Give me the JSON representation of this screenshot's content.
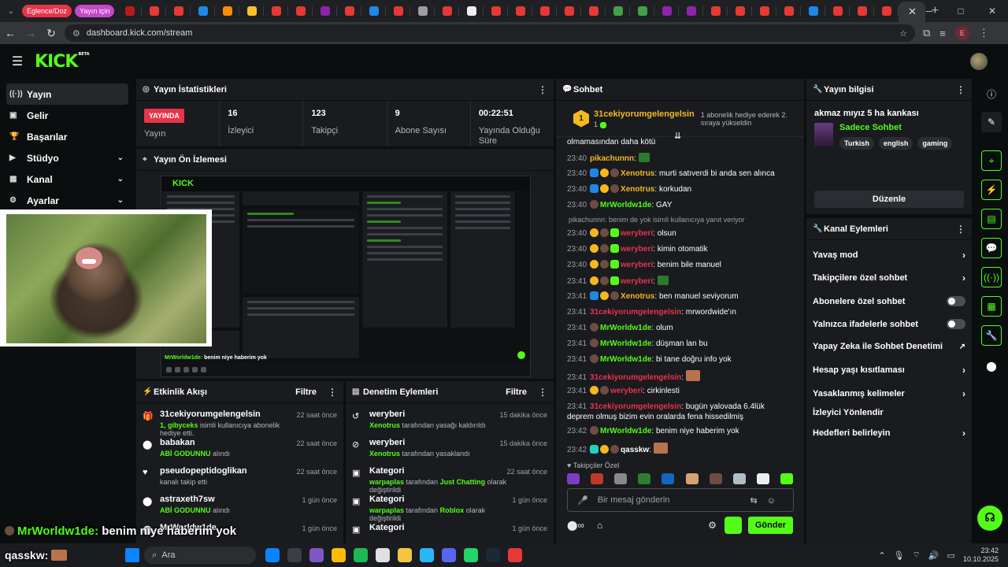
{
  "browser": {
    "tab_groups": [
      {
        "label": "Eglence/Doz",
        "color": "#e8344a"
      },
      {
        "label": "Yayın için",
        "color": "#c548c9"
      }
    ],
    "mini_tab_colors": [
      "#b71c1c",
      "#e53935",
      "#e53935",
      "#1e88e5",
      "#fb8c00",
      "#fbc02d",
      "#e53935",
      "#e53935",
      "#8e24aa",
      "#e53935",
      "#1e88e5",
      "#e53935",
      "#9e9e9e",
      "#e53935",
      "#eeeeee",
      "#e53935",
      "#e53935",
      "#e53935",
      "#e53935",
      "#e53935",
      "#43a047",
      "#43a047",
      "#8e24aa",
      "#8e24aa",
      "#e53935",
      "#e53935",
      "#e53935",
      "#e53935",
      "#1e88e5",
      "#e53935",
      "#e53935",
      "#e53935"
    ],
    "url": "dashboard.kick.com/stream",
    "profile_initial": "E"
  },
  "header": {
    "logo": "KICK",
    "logo_sup": "BETA"
  },
  "leftnav": {
    "items": [
      {
        "icon": "((·))",
        "label": "Yayın",
        "chevron": false,
        "active": true
      },
      {
        "icon": "▣",
        "label": "Gelir",
        "chevron": false,
        "active": false
      },
      {
        "icon": "🏆",
        "label": "Başarılar",
        "chevron": false,
        "active": false
      },
      {
        "icon": "▶",
        "label": "Stüdyo",
        "chevron": true,
        "active": false
      },
      {
        "icon": "▦",
        "label": "Kanal",
        "chevron": true,
        "active": false
      },
      {
        "icon": "⚙",
        "label": "Ayarlar",
        "chevron": true,
        "active": false
      }
    ]
  },
  "stats_panel": {
    "title": "Yayın İstatistikleri",
    "live_badge": "YAYINDA",
    "items": [
      {
        "value": "",
        "label": "Yayın"
      },
      {
        "value": "16",
        "label": "İzleyici"
      },
      {
        "value": "123",
        "label": "Takipçi"
      },
      {
        "value": "9",
        "label": "Abone Sayısı"
      },
      {
        "value": "00:22:51",
        "label": "Yayında Olduğu Süre"
      }
    ]
  },
  "preview_panel": {
    "title": "Yayın Ön İzlemesi",
    "inner_logo": "KICK",
    "inner_user": "MrWorldw1de:",
    "inner_msg": "benim niye haberim yok"
  },
  "activity_panel": {
    "title": "Etkinlik Akışı",
    "filter": "Filtre",
    "rows": [
      {
        "icon": "gift-icon",
        "glyph": "🎁",
        "title": "31cekiyorumgelengelsin",
        "highlight": "1, gibyceks",
        "rest": " isimli kullanıcıya abonelik hediye etti.",
        "time": "22 saat önce"
      },
      {
        "icon": "kicks-icon",
        "glyph": "⬤",
        "title": "babakan",
        "highlight": "ABİ GODUNNU",
        "rest": " alındı",
        "time": "22 saat önce"
      },
      {
        "icon": "heart-icon",
        "glyph": "♥",
        "title": "pseudopeptidoglikan",
        "highlight": "",
        "rest": "kanalı takip etti",
        "time": "22 saat önce"
      },
      {
        "icon": "kicks-icon",
        "glyph": "⬤",
        "title": "astraxeth7sw",
        "highlight": "ABİ GODUNNU",
        "rest": " alındı",
        "time": "1 gün önce"
      },
      {
        "icon": "kicks-icon",
        "glyph": "⬤",
        "title": "MrWorldw1de",
        "highlight": "",
        "rest": "",
        "time": "1 gün önce"
      }
    ]
  },
  "moderation_panel": {
    "title": "Denetim Eylemleri",
    "filter": "Filtre",
    "rows": [
      {
        "icon": "unban-icon",
        "glyph": "↺",
        "title": "weryberi",
        "highlight": "Xenotrus",
        "rest": " tarafından yasağı kaldırıldı",
        "highlight2": "",
        "rest2": "",
        "time": "15 dakika önce"
      },
      {
        "icon": "ban-icon",
        "glyph": "⊘",
        "title": "weryberi",
        "highlight": "Xenotrus",
        "rest": " tarafından yasaklandı",
        "highlight2": "",
        "rest2": "",
        "time": "15 dakika önce"
      },
      {
        "icon": "category-icon",
        "glyph": "▣",
        "title": "Kategori",
        "highlight": "warpaplas",
        "rest": " tarafından ",
        "highlight2": "Just Chatting",
        "rest2": " olarak değiştirildi",
        "time": "22 saat önce"
      },
      {
        "icon": "category-icon",
        "glyph": "▣",
        "title": "Kategori",
        "highlight": "warpaplas",
        "rest": " tarafından ",
        "highlight2": "Roblox",
        "rest2": " olarak değiştirildi",
        "time": "1 gün önce"
      },
      {
        "icon": "category-icon",
        "glyph": "▣",
        "title": "Kategori",
        "highlight": "",
        "rest": "",
        "highlight2": "",
        "rest2": "",
        "time": "1 gün önce"
      }
    ]
  },
  "chat_panel": {
    "title": "Sohbet",
    "pinned": {
      "rank": "1",
      "name": "31cekiyorumgelengelsin",
      "sub": "1",
      "text": "1 abonelik hediye ederek 2. sıraya yükseldin"
    },
    "messages": [
      {
        "time": "",
        "badges": [],
        "user": "",
        "color": "#fff",
        "text": "olmamasından daha kötü",
        "emote": ""
      },
      {
        "time": "23:40",
        "badges": [],
        "user": "pikachunnn",
        "color": "#f5b820",
        "text": "",
        "emote": "green"
      },
      {
        "time": "23:40",
        "badges": [
          "blue",
          "gold",
          "gray"
        ],
        "user": "Xenotrus",
        "color": "#f5b820",
        "text": "murti satıverdi bi anda sen alınca",
        "emote": ""
      },
      {
        "time": "23:40",
        "badges": [
          "blue",
          "gold",
          "gray"
        ],
        "user": "Xenotrus",
        "color": "#f5b820",
        "text": "korkudan",
        "emote": ""
      },
      {
        "time": "23:40",
        "badges": [
          "gray"
        ],
        "user": "MrWorldw1de",
        "color": "#53fc18",
        "text": "GAY",
        "emote": ""
      },
      {
        "time": "23:40",
        "badges": [
          "gold",
          "gray",
          "green"
        ],
        "user": "weryberi",
        "color": "#e8344a",
        "text": "olsun",
        "emote": ""
      },
      {
        "time": "23:40",
        "badges": [
          "gold",
          "gray",
          "green"
        ],
        "user": "weryberi",
        "color": "#e8344a",
        "text": "kimin otomatik",
        "emote": ""
      },
      {
        "time": "23:40",
        "badges": [
          "gold",
          "gray",
          "green"
        ],
        "user": "weryberi",
        "color": "#e8344a",
        "text": "benim bile manuel",
        "emote": ""
      },
      {
        "time": "23:41",
        "badges": [
          "gold",
          "gray",
          "green"
        ],
        "user": "weryberi",
        "color": "#e8344a",
        "text": "",
        "emote": "green"
      },
      {
        "time": "23:41",
        "badges": [
          "blue",
          "gold",
          "gray"
        ],
        "user": "Xenotrus",
        "color": "#f5b820",
        "text": "ben manuel seviyorum",
        "emote": ""
      },
      {
        "time": "23:41",
        "badges": [],
        "user": "31cekiyorumgelengelsin",
        "color": "#e8344a",
        "text": "mrwordwide'ın",
        "emote": ""
      },
      {
        "time": "23:41",
        "badges": [
          "gray"
        ],
        "user": "MrWorldw1de",
        "color": "#53fc18",
        "text": "olum",
        "emote": ""
      },
      {
        "time": "23:41",
        "badges": [
          "gray"
        ],
        "user": "MrWorldw1de",
        "color": "#53fc18",
        "text": "düşman lan bu",
        "emote": ""
      },
      {
        "time": "23:41",
        "badges": [
          "gray"
        ],
        "user": "MrWorldw1de",
        "color": "#53fc18",
        "text": "bi tane doğru info yok",
        "emote": ""
      },
      {
        "time": "23:41",
        "badges": [],
        "user": "31cekiyorumgelengelsin",
        "color": "#e8344a",
        "text": "",
        "emote": "big"
      },
      {
        "time": "23:41",
        "badges": [
          "gold",
          "gray"
        ],
        "user": "weryberi",
        "color": "#e8344a",
        "text": "cirkinlesti",
        "emote": ""
      },
      {
        "time": "23:41",
        "badges": [],
        "user": "31cekiyorumgelengelsin",
        "color": "#e8344a",
        "text": "bugün yalovada 6.4lük deprem olmuş bizim evin oralarda fena hissedilmiş",
        "emote": ""
      },
      {
        "time": "23:42",
        "badges": [
          "gray"
        ],
        "user": "MrWorldw1de",
        "color": "#53fc18",
        "text": "benim niye haberim yok",
        "emote": ""
      },
      {
        "time": "23:42",
        "badges": [
          "teal",
          "gold",
          "gray"
        ],
        "user": "qasskw",
        "color": "#fff",
        "text": "",
        "emote": "big"
      }
    ],
    "reply_hint": "pikachunnn: benim de yok isimli kullanıcıya yanıt veriyor",
    "followers_label": "Takipçiler Özel",
    "emote_colors": [
      "#7b3fc4",
      "#c0392b",
      "#888",
      "#2e7d32",
      "#1565c0",
      "#d4a373",
      "#6d4c41",
      "#b0bec5",
      "#eceff1",
      "#53fc18"
    ],
    "input_placeholder": "Bir mesaj gönderin",
    "send_label": "Gönder"
  },
  "stream_info": {
    "title": "Yayın bilgisi",
    "stream_title": "akmaz mıyız 5 ha kankası",
    "category": "Sadece Sohbet",
    "tags": [
      "Turkish",
      "english",
      "gaming"
    ],
    "edit_label": "Düzenle"
  },
  "channel_actions": {
    "title": "Kanal Eylemleri",
    "items": [
      {
        "label": "Yavaş mod",
        "control": "arrow"
      },
      {
        "label": "Takipçilere özel sohbet",
        "control": "arrow"
      },
      {
        "label": "Abonelere özel sohbet",
        "control": "toggle"
      },
      {
        "label": "Yalnızca ifadelerle sohbet",
        "control": "toggle"
      },
      {
        "label": "Yapay Zeka ile Sohbet Denetimi",
        "control": "external"
      },
      {
        "label": "Hesap yaşı kısıtlaması",
        "control": "arrow"
      },
      {
        "label": "Yasaklanmış kelimeler",
        "control": "arrow"
      },
      {
        "label": "İzleyici Yönlendir",
        "control": "none"
      },
      {
        "label": "Hedefleri belirleyin",
        "control": "arrow"
      }
    ]
  },
  "overlay_chat": [
    {
      "user": "MrWorldw1de:",
      "text": "benim niye haberim yok",
      "color": "#53fc18"
    },
    {
      "user": "qasskw:",
      "text": "",
      "color": "#fff"
    }
  ],
  "taskbar": {
    "search_label": "Ara",
    "time": "23:42",
    "date": "10.10.2025",
    "app_colors": [
      "#0a84ff",
      "#3a3f47",
      "#7e57c2",
      "#fbbc05",
      "#1db954",
      "#e0e0e0",
      "#f5c542",
      "#29b6f6",
      "#5865f2",
      "#25d366",
      "#1b2838",
      "#e53935"
    ]
  }
}
